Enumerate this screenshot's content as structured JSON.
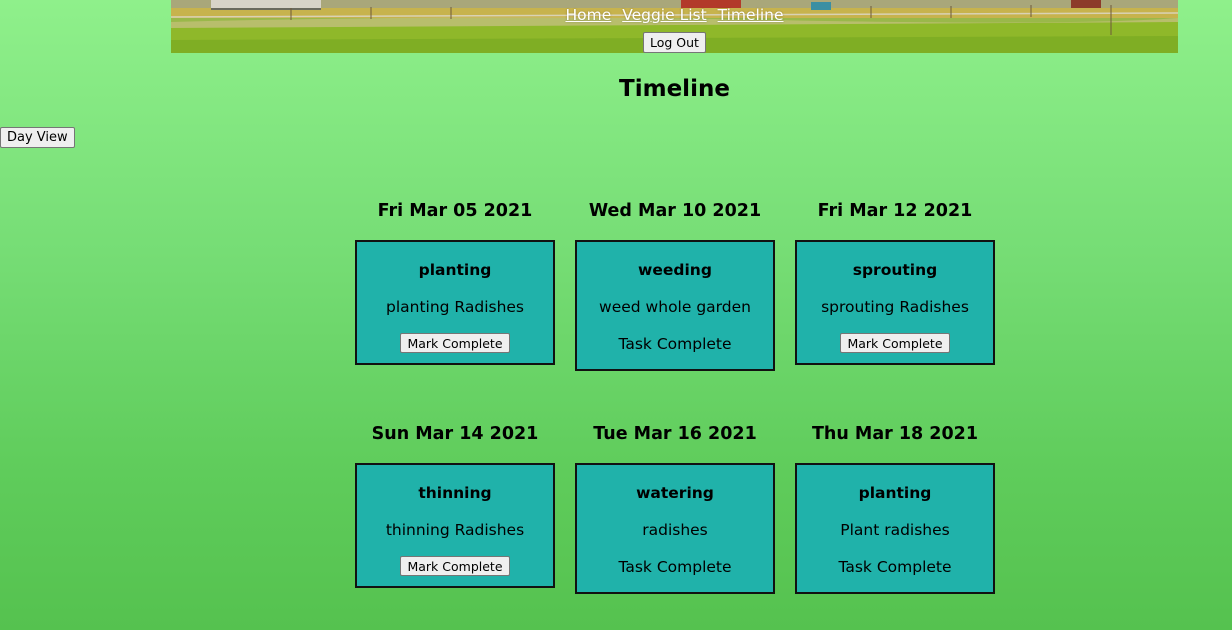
{
  "nav": {
    "links": [
      "Home",
      "Veggie List",
      "Timeline"
    ],
    "logout_label": "Log Out"
  },
  "page": {
    "title": "Timeline",
    "day_view_label": "Day View"
  },
  "timeline": [
    {
      "date": "Fri Mar 05 2021",
      "task": "planting",
      "description": "planting Radishes",
      "action": "Mark Complete",
      "status": ""
    },
    {
      "date": "Wed Mar 10 2021",
      "task": "weeding",
      "description": "weed whole garden",
      "action": "",
      "status": "Task Complete"
    },
    {
      "date": "Fri Mar 12 2021",
      "task": "sprouting",
      "description": "sprouting Radishes",
      "action": "Mark Complete",
      "status": ""
    },
    {
      "date": "Sun Mar 14 2021",
      "task": "thinning",
      "description": "thinning Radishes",
      "action": "Mark Complete",
      "status": ""
    },
    {
      "date": "Tue Mar 16 2021",
      "task": "watering",
      "description": "radishes",
      "action": "",
      "status": "Task Complete"
    },
    {
      "date": "Thu Mar 18 2021",
      "task": "planting",
      "description": "Plant radishes",
      "action": "",
      "status": "Task Complete"
    }
  ],
  "colors": {
    "card_background": "#20b2aa",
    "page_background_top": "#8ff08b",
    "page_background_bottom": "#55c24f"
  }
}
